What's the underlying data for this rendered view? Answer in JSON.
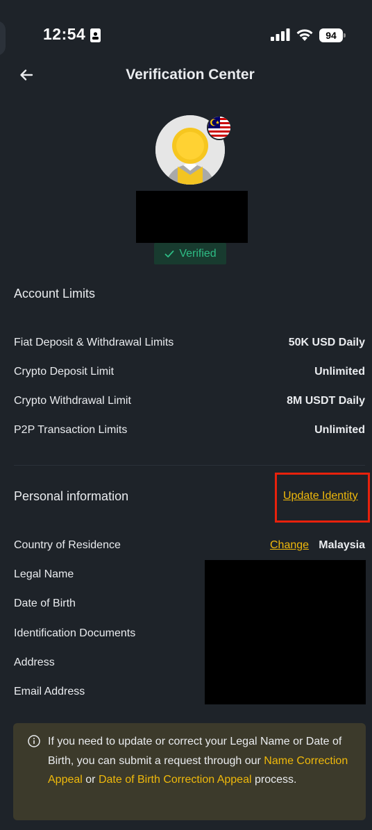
{
  "status_bar": {
    "time": "12:54",
    "battery": "94",
    "icons": [
      "id-card-icon",
      "signal-icon",
      "wifi-icon",
      "battery-icon"
    ]
  },
  "header": {
    "title": "Verification Center",
    "back_icon": "arrow-left-icon"
  },
  "profile": {
    "verified_label": "Verified",
    "flag": "malaysia-flag-icon"
  },
  "account_limits": {
    "title": "Account Limits",
    "rows": [
      {
        "label": "Fiat Deposit & Withdrawal Limits",
        "value": "50K USD Daily"
      },
      {
        "label": "Crypto Deposit Limit",
        "value": "Unlimited"
      },
      {
        "label": "Crypto Withdrawal Limit",
        "value": "8M USDT Daily"
      },
      {
        "label": "P2P Transaction Limits",
        "value": "Unlimited"
      }
    ]
  },
  "personal_info": {
    "title": "Personal information",
    "update_link": "Update Identity",
    "rows": [
      {
        "label": "Country of Residence",
        "link": "Change",
        "value": "Malaysia"
      },
      {
        "label": "Legal Name"
      },
      {
        "label": "Date of Birth"
      },
      {
        "label": "Identification Documents"
      },
      {
        "label": "Address"
      },
      {
        "label": "Email Address"
      }
    ]
  },
  "notice": {
    "icon": "info-circle-icon",
    "text_1": "If you need to update or correct your Legal Name or Date of Birth, you can submit a request through our ",
    "link_1": "Name Correction Appeal",
    "text_2": " or ",
    "link_2": "Date of Birth Correction Appeal",
    "text_3": " process."
  },
  "colors": {
    "background": "#1e2329",
    "accent": "#f0b90b",
    "verified": "#2ebd85",
    "highlight": "#e8210c",
    "notice_bg": "#3c3a2b"
  }
}
